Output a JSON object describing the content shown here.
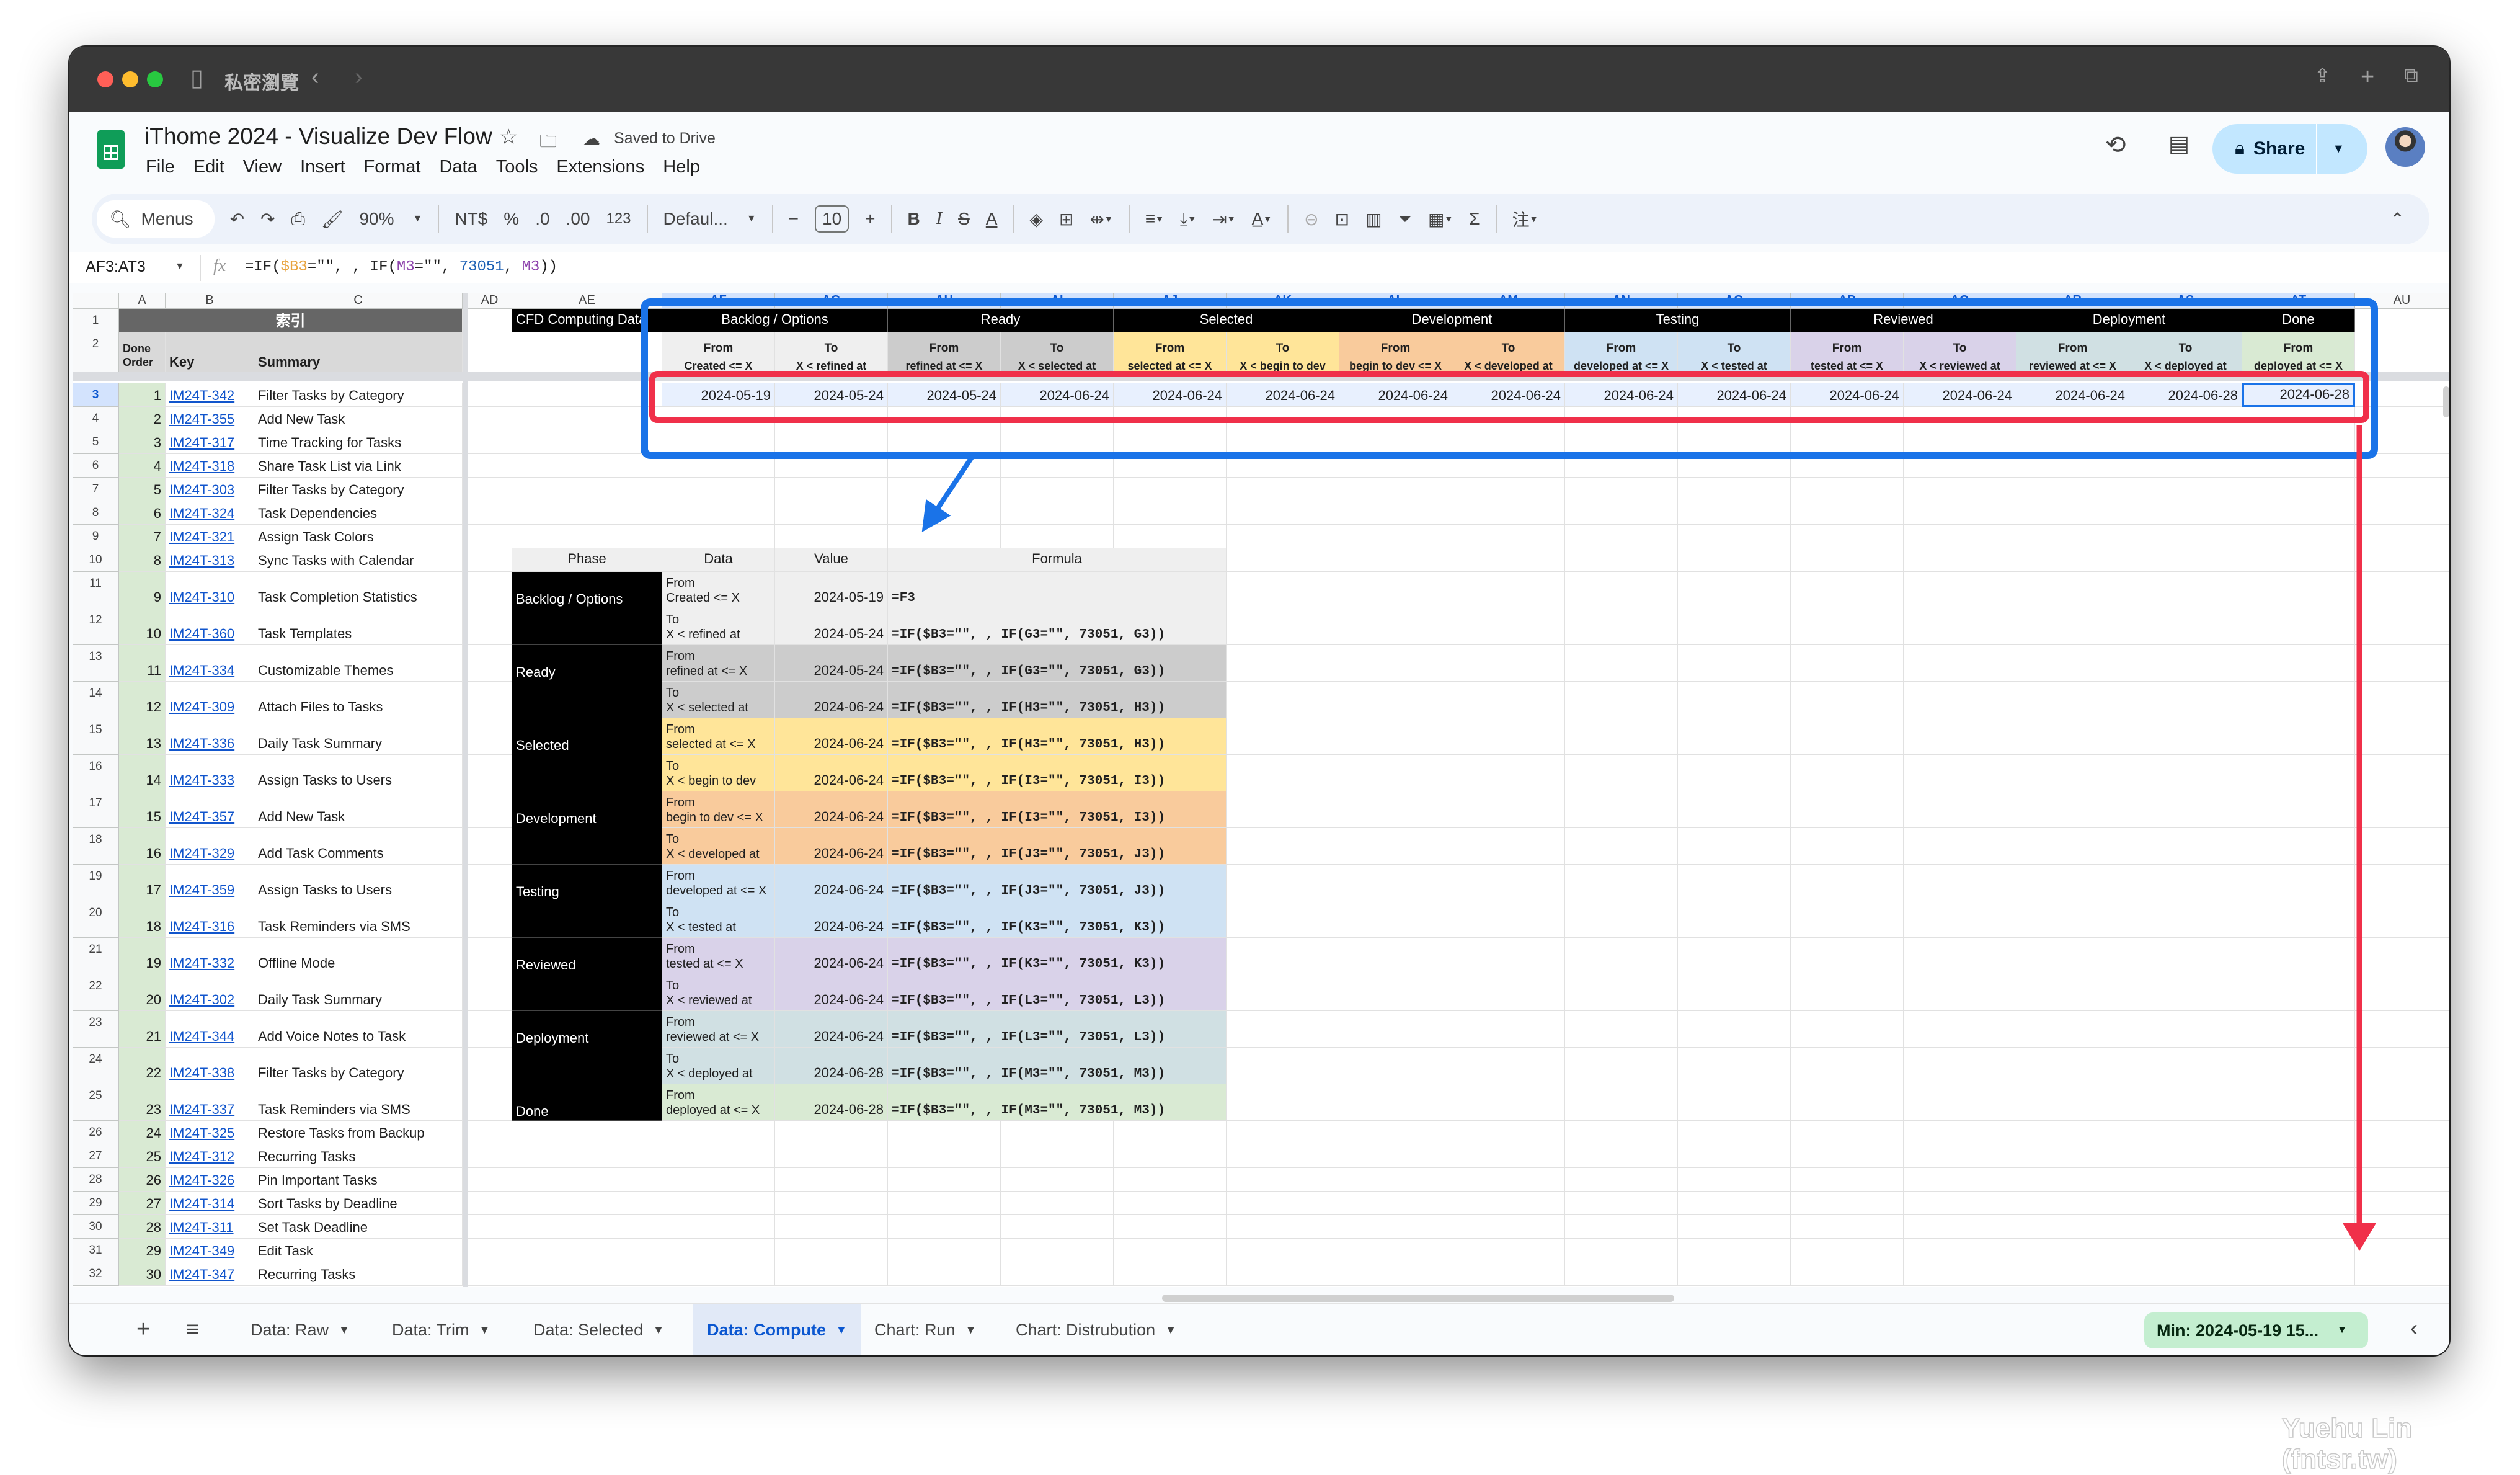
{
  "browser": {
    "private_label": "私密瀏覽"
  },
  "header": {
    "title": "iThome 2024 - Visualize Dev Flow",
    "saved_status": "Saved to Drive",
    "menus": [
      "File",
      "Edit",
      "View",
      "Insert",
      "Format",
      "Data",
      "Tools",
      "Extensions",
      "Help"
    ],
    "share_label": "Share"
  },
  "toolbar": {
    "menus_label": "Menus",
    "zoom": "90%",
    "currency": "NT$",
    "percent": "%",
    "dec_decrease": ".0",
    "dec_increase": ".00",
    "number_format": "123",
    "font": "Defaul...",
    "font_size": "10"
  },
  "formula_bar": {
    "cell_ref": "AF3:AT3",
    "formula_parts": [
      {
        "text": "=IF(",
        "color": "#1f1f1f"
      },
      {
        "text": "$B3",
        "color": "#e8a33d"
      },
      {
        "text": "=\"\", , IF(",
        "color": "#1f1f1f"
      },
      {
        "text": "M3",
        "color": "#8e44ad"
      },
      {
        "text": "=\"\", ",
        "color": "#1f1f1f"
      },
      {
        "text": "73051",
        "color": "#1a5fb4"
      },
      {
        "text": ", ",
        "color": "#1f1f1f"
      },
      {
        "text": "M3",
        "color": "#8e44ad"
      },
      {
        "text": "))",
        "color": "#1f1f1f"
      }
    ]
  },
  "grid": {
    "columns": [
      "A",
      "B",
      "C",
      "AD",
      "AE",
      "AF",
      "AG",
      "AH",
      "AI",
      "AJ",
      "AK",
      "AL",
      "AM",
      "AN",
      "AO",
      "AP",
      "AQ",
      "AR",
      "AS",
      "AT",
      "AU"
    ],
    "row_numbers": [
      "1",
      "2",
      "3",
      "4",
      "5",
      "6",
      "7",
      "8",
      "9",
      "10",
      "11",
      "12",
      "13",
      "14",
      "15",
      "16",
      "17",
      "18",
      "19",
      "20",
      "21",
      "22",
      "23",
      "24",
      "25",
      "26",
      "27",
      "28",
      "29",
      "30",
      "31",
      "32"
    ],
    "selected_range": "AF3:AT3"
  },
  "index_table": {
    "title": "索引",
    "headers": [
      "Done Order",
      "Key",
      "Summary"
    ],
    "rows": [
      {
        "order": "1",
        "key": "IM24T-342",
        "summary": "Filter Tasks by Category"
      },
      {
        "order": "2",
        "key": "IM24T-355",
        "summary": "Add New Task"
      },
      {
        "order": "3",
        "key": "IM24T-317",
        "summary": "Time Tracking for Tasks"
      },
      {
        "order": "4",
        "key": "IM24T-318",
        "summary": "Share Task List via Link"
      },
      {
        "order": "5",
        "key": "IM24T-303",
        "summary": "Filter Tasks by Category"
      },
      {
        "order": "6",
        "key": "IM24T-324",
        "summary": "Task Dependencies"
      },
      {
        "order": "7",
        "key": "IM24T-321",
        "summary": "Assign Task Colors"
      },
      {
        "order": "8",
        "key": "IM24T-313",
        "summary": "Sync Tasks with Calendar"
      },
      {
        "order": "9",
        "key": "IM24T-310",
        "summary": "Task Completion Statistics"
      },
      {
        "order": "10",
        "key": "IM24T-360",
        "summary": "Task Templates"
      },
      {
        "order": "11",
        "key": "IM24T-334",
        "summary": "Customizable Themes"
      },
      {
        "order": "12",
        "key": "IM24T-309",
        "summary": "Attach Files to Tasks"
      },
      {
        "order": "13",
        "key": "IM24T-336",
        "summary": "Daily Task Summary"
      },
      {
        "order": "14",
        "key": "IM24T-333",
        "summary": "Assign Tasks to Users"
      },
      {
        "order": "15",
        "key": "IM24T-357",
        "summary": "Add New Task"
      },
      {
        "order": "16",
        "key": "IM24T-329",
        "summary": "Add Task Comments"
      },
      {
        "order": "17",
        "key": "IM24T-359",
        "summary": "Assign Tasks to Users"
      },
      {
        "order": "18",
        "key": "IM24T-316",
        "summary": "Task Reminders via SMS"
      },
      {
        "order": "19",
        "key": "IM24T-332",
        "summary": "Offline Mode"
      },
      {
        "order": "20",
        "key": "IM24T-302",
        "summary": "Daily Task Summary"
      },
      {
        "order": "21",
        "key": "IM24T-344",
        "summary": "Add Voice Notes to Task"
      },
      {
        "order": "22",
        "key": "IM24T-338",
        "summary": "Filter Tasks by Category"
      },
      {
        "order": "23",
        "key": "IM24T-337",
        "summary": "Task Reminders via SMS"
      },
      {
        "order": "24",
        "key": "IM24T-325",
        "summary": "Restore Tasks from Backup"
      },
      {
        "order": "25",
        "key": "IM24T-312",
        "summary": "Recurring Tasks"
      },
      {
        "order": "26",
        "key": "IM24T-326",
        "summary": "Pin Important Tasks"
      },
      {
        "order": "27",
        "key": "IM24T-314",
        "summary": "Sort Tasks by Deadline"
      },
      {
        "order": "28",
        "key": "IM24T-311",
        "summary": "Set Task Deadline"
      },
      {
        "order": "29",
        "key": "IM24T-349",
        "summary": "Edit Task"
      },
      {
        "order": "30",
        "key": "IM24T-347",
        "summary": "Recurring Tasks"
      }
    ]
  },
  "cfd": {
    "title": "CFD Computing Data",
    "phases": [
      {
        "name": "Backlog / Options",
        "color": "#efefef",
        "subs": [
          {
            "label": "From",
            "detail": "Created <= X"
          },
          {
            "label": "To",
            "detail": "X < refined at"
          }
        ]
      },
      {
        "name": "Ready",
        "color": "#cccccc",
        "subs": [
          {
            "label": "From",
            "detail": "refined at <= X"
          },
          {
            "label": "To",
            "detail": "X < selected at"
          }
        ]
      },
      {
        "name": "Selected",
        "color": "#ffe599",
        "subs": [
          {
            "label": "From",
            "detail": "selected at <= X"
          },
          {
            "label": "To",
            "detail": "X < begin to dev"
          }
        ]
      },
      {
        "name": "Development",
        "color": "#f9cb9c",
        "subs": [
          {
            "label": "From",
            "detail": "begin to dev <= X"
          },
          {
            "label": "To",
            "detail": "X < developed at"
          }
        ]
      },
      {
        "name": "Testing",
        "color": "#cfe2f3",
        "subs": [
          {
            "label": "From",
            "detail": "developed at <= X"
          },
          {
            "label": "To",
            "detail": "X < tested at"
          }
        ]
      },
      {
        "name": "Reviewed",
        "color": "#d9d2e9",
        "subs": [
          {
            "label": "From",
            "detail": "tested at <= X"
          },
          {
            "label": "To",
            "detail": "X < reviewed at"
          }
        ]
      },
      {
        "name": "Deployment",
        "color": "#d0e0e3",
        "subs": [
          {
            "label": "From",
            "detail": "reviewed at <= X"
          },
          {
            "label": "To",
            "detail": "X < deployed at"
          }
        ]
      },
      {
        "name": "Done",
        "color": "#d9ead3",
        "subs": [
          {
            "label": "From",
            "detail": "deployed at <= X"
          }
        ]
      }
    ],
    "row3_values": [
      "2024-05-19",
      "2024-05-24",
      "2024-05-24",
      "2024-06-24",
      "2024-06-24",
      "2024-06-24",
      "2024-06-24",
      "2024-06-24",
      "2024-06-24",
      "2024-06-24",
      "2024-06-24",
      "2024-06-24",
      "2024-06-24",
      "2024-06-28",
      "2024-06-28"
    ]
  },
  "compute_table": {
    "headers": [
      "Phase",
      "Data",
      "Value",
      "Formula"
    ],
    "rows": [
      {
        "phase": "Backlog / Options",
        "label": "From",
        "detail": "Created <= X",
        "value": "2024-05-19",
        "formula": "=F3"
      },
      {
        "phase": "",
        "label": "To",
        "detail": "X < refined at",
        "value": "2024-05-24",
        "formula": "=IF($B3=\"\", , IF(G3=\"\", 73051, G3))"
      },
      {
        "phase": "Ready",
        "label": "From",
        "detail": "refined at <= X",
        "value": "2024-05-24",
        "formula": "=IF($B3=\"\", , IF(G3=\"\", 73051, G3))"
      },
      {
        "phase": "",
        "label": "To",
        "detail": "X < selected at",
        "value": "2024-06-24",
        "formula": "=IF($B3=\"\", , IF(H3=\"\", 73051, H3))"
      },
      {
        "phase": "Selected",
        "label": "From",
        "detail": "selected at <= X",
        "value": "2024-06-24",
        "formula": "=IF($B3=\"\", , IF(H3=\"\", 73051, H3))"
      },
      {
        "phase": "",
        "label": "To",
        "detail": "X < begin to dev",
        "value": "2024-06-24",
        "formula": "=IF($B3=\"\", , IF(I3=\"\", 73051, I3))"
      },
      {
        "phase": "Development",
        "label": "From",
        "detail": "begin to dev <= X",
        "value": "2024-06-24",
        "formula": "=IF($B3=\"\", , IF(I3=\"\", 73051, I3))"
      },
      {
        "phase": "",
        "label": "To",
        "detail": "X < developed at",
        "value": "2024-06-24",
        "formula": "=IF($B3=\"\", , IF(J3=\"\", 73051, J3))"
      },
      {
        "phase": "Testing",
        "label": "From",
        "detail": "developed at <= X",
        "value": "2024-06-24",
        "formula": "=IF($B3=\"\", , IF(J3=\"\", 73051, J3))"
      },
      {
        "phase": "",
        "label": "To",
        "detail": "X < tested at",
        "value": "2024-06-24",
        "formula": "=IF($B3=\"\", , IF(K3=\"\", 73051, K3))"
      },
      {
        "phase": "Reviewed",
        "label": "From",
        "detail": "tested at <= X",
        "value": "2024-06-24",
        "formula": "=IF($B3=\"\", , IF(K3=\"\", 73051, K3))"
      },
      {
        "phase": "",
        "label": "To",
        "detail": "X < reviewed at",
        "value": "2024-06-24",
        "formula": "=IF($B3=\"\", , IF(L3=\"\", 73051, L3))"
      },
      {
        "phase": "Deployment",
        "label": "From",
        "detail": "reviewed at <= X",
        "value": "2024-06-24",
        "formula": "=IF($B3=\"\", , IF(L3=\"\", 73051, L3))"
      },
      {
        "phase": "",
        "label": "To",
        "detail": "X < deployed at",
        "value": "2024-06-28",
        "formula": "=IF($B3=\"\", , IF(M3=\"\", 73051, M3))"
      },
      {
        "phase": "Done",
        "label": "From",
        "detail": "deployed at <= X",
        "value": "2024-06-28",
        "formula": "=IF($B3=\"\", , IF(M3=\"\", 73051, M3))"
      }
    ]
  },
  "sheet_tabs": [
    {
      "label": "Data: Raw",
      "active": false
    },
    {
      "label": "Data: Trim",
      "active": false
    },
    {
      "label": "Data: Selected",
      "active": false
    },
    {
      "label": "Data: Compute",
      "active": true
    },
    {
      "label": "Chart: Run",
      "active": false
    },
    {
      "label": "Chart: Distrubution",
      "active": false
    }
  ],
  "status_chip": "Min: 2024-05-19 15...",
  "watermark": "Yuehu Lin (fntsr.tw)",
  "annotation_colors": {
    "highlight_box": "#1a73e8",
    "row_box": "#f0304a"
  }
}
